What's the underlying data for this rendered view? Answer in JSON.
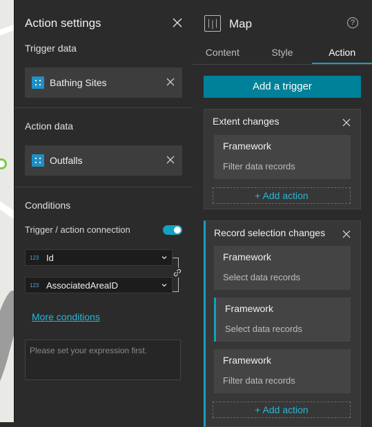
{
  "action_settings": {
    "title": "Action settings",
    "trigger_data_label": "Trigger data",
    "trigger_source": "Bathing Sites",
    "action_data_label": "Action data",
    "action_source": "Outfalls",
    "conditions_label": "Conditions",
    "connection_label": "Trigger / action connection",
    "connection_enabled": true,
    "trigger_field": {
      "type": "123",
      "name": "Id"
    },
    "action_field": {
      "type": "123",
      "name": "AssociatedAreaID"
    },
    "more_conditions": "More conditions",
    "expression_placeholder": "Please set your expression first."
  },
  "map_panel": {
    "title": "Map",
    "help": "?",
    "tabs": [
      "Content",
      "Style",
      "Action"
    ],
    "active_tab": "Action",
    "add_trigger": "Add a trigger",
    "triggers": [
      {
        "title": "Extent changes",
        "actions": [
          {
            "name": "Framework",
            "desc": "Filter data records"
          }
        ],
        "add_action": "+ Add action"
      },
      {
        "title": "Record selection changes",
        "actions": [
          {
            "name": "Framework",
            "desc": "Select data records"
          },
          {
            "name": "Framework",
            "desc": "Select data records"
          },
          {
            "name": "Framework",
            "desc": "Filter data records"
          }
        ],
        "add_action": "+ Add action"
      }
    ]
  },
  "colors": {
    "accent": "#16a0c0",
    "button": "#00819a",
    "link": "#25b7d8",
    "layer_icon": "#1f8fc5"
  }
}
